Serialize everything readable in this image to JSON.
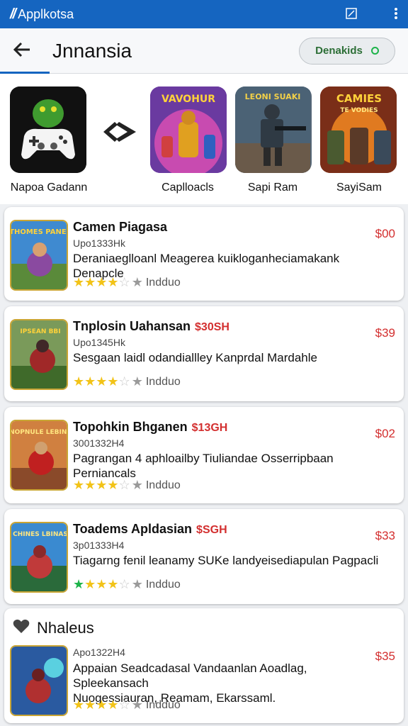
{
  "appbar": {
    "brand": "Applkotsa"
  },
  "header": {
    "back_icon": "arrow-left",
    "title": "Jnnansia",
    "pill_label": "Denakids"
  },
  "carousel": [
    {
      "label": "Napoa Gadann"
    },
    {
      "label": "Caplloacls"
    },
    {
      "label": "Sapi Ram"
    },
    {
      "label": "SayiSam"
    }
  ],
  "carousel_art_text": [
    "VAVOHUR",
    "LEONI SUAKI",
    "CAMIES",
    "TE VODIES"
  ],
  "cards": [
    {
      "title": "Camen Piagasa",
      "tag": "",
      "id": "Upo1333Hk",
      "desc": "Deraniaeglloanl Meagerea kuikloganheciamakank Denapcle",
      "price": "$00",
      "rating_label": "Indduo",
      "thumb_text": "THOMES PANES"
    },
    {
      "title": "Tnplosin Uahansan",
      "tag": "$30SH",
      "id": "Upo1345Hk",
      "desc": "Sesgaan laidl odandiallley Kanprdal Mardahle",
      "price": "$39",
      "rating_label": "Indduo",
      "thumb_text": "IPSEAN BBI"
    },
    {
      "title": "Topohkin Bhganen",
      "tag": "$13GH",
      "id": "3001332H4",
      "desc": "Pagrangan 4 aphloailby Tiuliandae Osserripbaan Perniancals",
      "price": "$02",
      "rating_label": "Indduo",
      "thumb_text": "NOPNULE LEBINS"
    },
    {
      "title": "Toadems Apldasian",
      "tag": "$SGH",
      "id": "3p01333H4",
      "desc": "Tiagarng fenil leanamy SUKe landyeisediapulan Pagpacli",
      "price": "$33",
      "rating_label": "Indduo",
      "thumb_text": "CHINES LBINAS"
    }
  ],
  "section": {
    "title": "Nhaleus",
    "item": {
      "id": "Apo1322H4",
      "desc_line1": "Appaian Seadcadasal Vandaanlan Aoadlag, Spleekansach",
      "desc_line2": "Nuogessiauran, Reamam, Ekarssaml.",
      "price": "$35",
      "rating_label": "Indduo"
    }
  },
  "colors": {
    "appbar": "#1565c0",
    "price": "#d32f2f",
    "star": "#f2c318",
    "status_green": "#1db34a"
  }
}
